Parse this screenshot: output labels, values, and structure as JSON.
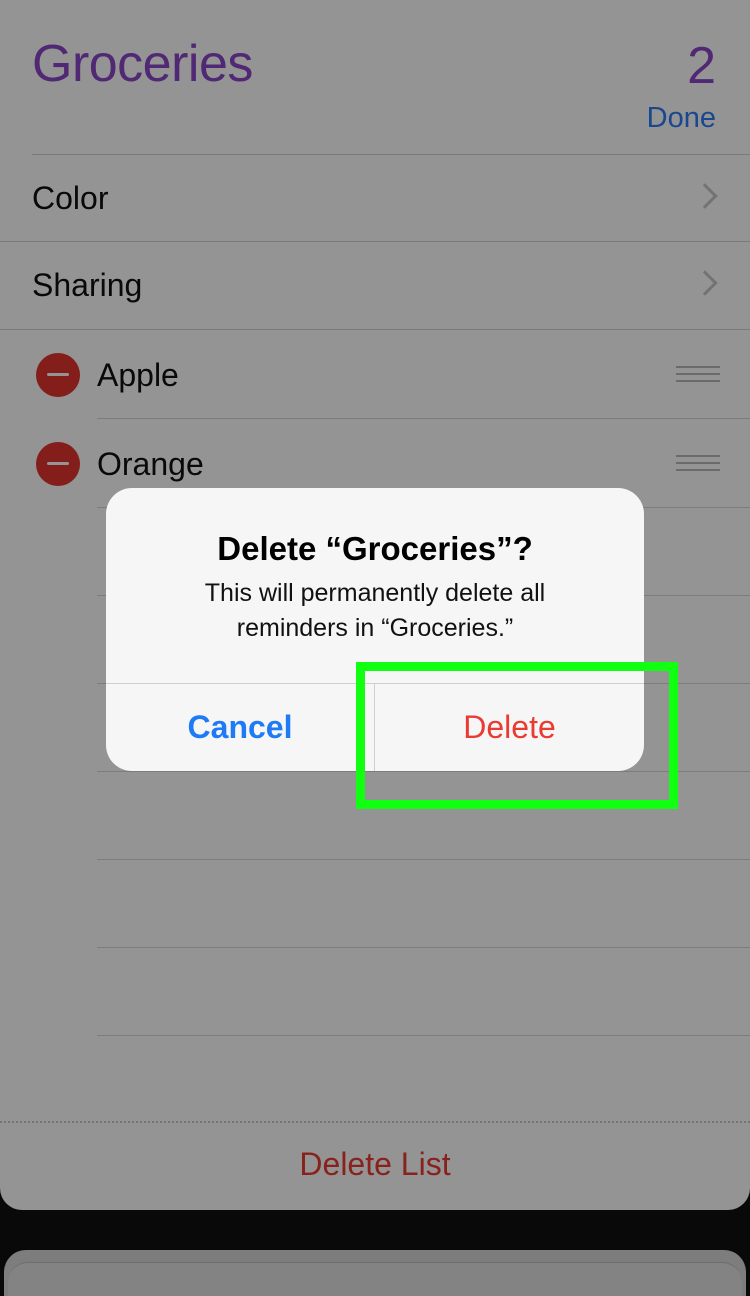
{
  "list": {
    "title": "Groceries",
    "count": "2",
    "done_label": "Done"
  },
  "settings": [
    {
      "label": "Color"
    },
    {
      "label": "Sharing"
    }
  ],
  "items": [
    {
      "label": "Apple"
    },
    {
      "label": "Orange"
    }
  ],
  "footer": {
    "delete_list_label": "Delete List"
  },
  "alert": {
    "title": "Delete “Groceries”?",
    "message": "This will permanently delete all reminders in “Groceries.”",
    "cancel_label": "Cancel",
    "delete_label": "Delete"
  },
  "colors": {
    "accent_purple": "#8a46c8",
    "link_blue": "#2d7cf6",
    "destructive_red": "#ea3b33",
    "highlight_green": "#11ff11"
  }
}
